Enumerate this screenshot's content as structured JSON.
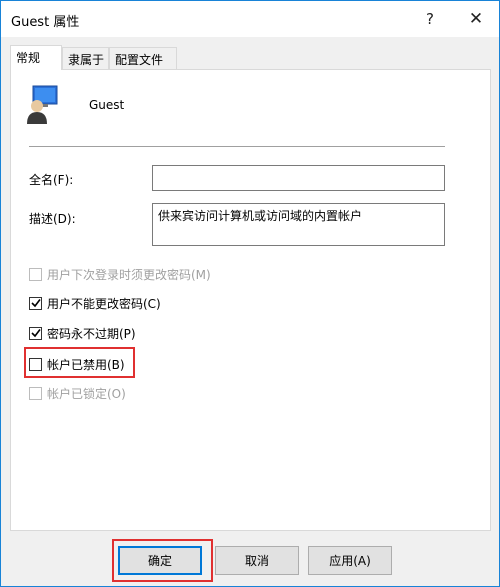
{
  "window": {
    "title": "Guest 属性",
    "help_glyph": "?",
    "close_glyph": "✕"
  },
  "tabs": [
    {
      "label": "常规",
      "active": true
    },
    {
      "label": "隶属于",
      "active": false
    },
    {
      "label": "配置文件",
      "active": false
    }
  ],
  "user": {
    "name": "Guest",
    "icon": "user-account-icon"
  },
  "fields": {
    "fullname_label": "全名(F):",
    "fullname_value": "",
    "description_label": "描述(D):",
    "description_value": "供来宾访问计算机或访问域的内置帐户"
  },
  "checkboxes": [
    {
      "label": "用户下次登录时须更改密码(M)",
      "checked": false,
      "disabled": true
    },
    {
      "label": "用户不能更改密码(C)",
      "checked": true,
      "disabled": false
    },
    {
      "label": "密码永不过期(P)",
      "checked": true,
      "disabled": false
    },
    {
      "label": "帐户已禁用(B)",
      "checked": false,
      "disabled": false
    },
    {
      "label": "帐户已锁定(O)",
      "checked": false,
      "disabled": true
    }
  ],
  "buttons": {
    "ok": "确定",
    "cancel": "取消",
    "apply": "应用(A)"
  },
  "colors": {
    "accent": "#0078d7",
    "highlight": "#e03030"
  }
}
